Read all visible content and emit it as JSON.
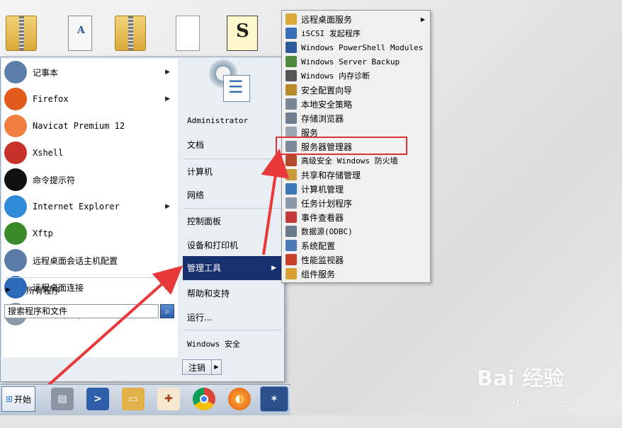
{
  "desktop_icons": [
    "zip-folder-icon",
    "document-icon",
    "zip-folder-icon",
    "blank-file-icon",
    "script-file-icon"
  ],
  "start_menu": {
    "programs": [
      {
        "label": "记事本",
        "icon": "notepad-icon",
        "has_arrow": true
      },
      {
        "label": "Firefox",
        "icon": "firefox-icon",
        "has_arrow": true
      },
      {
        "label": "Navicat Premium 12",
        "icon": "navicat-icon",
        "has_arrow": false
      },
      {
        "label": "Xshell",
        "icon": "xshell-icon",
        "has_arrow": false
      },
      {
        "label": "命令提示符",
        "icon": "cmd-icon",
        "has_arrow": false
      },
      {
        "label": "Internet Explorer",
        "icon": "ie-icon",
        "has_arrow": true
      },
      {
        "label": "Xftp",
        "icon": "xftp-icon",
        "has_arrow": false
      },
      {
        "label": "远程桌面会话主机配置",
        "icon": "rdsh-config-icon",
        "has_arrow": false
      },
      {
        "label": "远程桌面连接",
        "icon": "remote-desktop-icon",
        "has_arrow": true
      },
      {
        "label": "任务计划程序",
        "icon": "task-scheduler-icon",
        "has_arrow": false
      }
    ],
    "all_programs": "所有程序",
    "search_placeholder": "搜索程序和文件",
    "right_items": {
      "user": "Administrator",
      "documents": "文档",
      "computer": "计算机",
      "network": "网络",
      "control_panel": "控制面板",
      "devices": "设备和打印机",
      "admin_tools": "管理工具",
      "help": "帮助和支持",
      "run": "运行...",
      "security": "Windows 安全"
    },
    "logout": "注销"
  },
  "admin_submenu": [
    {
      "label": "远程桌面服务",
      "color": "#d9a93a",
      "has_arrow": true
    },
    {
      "label": "iSCSI 发起程序",
      "color": "#3a6fb8",
      "has_arrow": false
    },
    {
      "label": "Windows PowerShell Modules",
      "color": "#2c5c9c",
      "has_arrow": false
    },
    {
      "label": "Windows Server Backup",
      "color": "#4d8a3c",
      "has_arrow": false
    },
    {
      "label": "Windows 内存诊断",
      "color": "#555555",
      "has_arrow": false
    },
    {
      "label": "安全配置向导",
      "color": "#b88a2a",
      "has_arrow": false
    },
    {
      "label": "本地安全策略",
      "color": "#7a8794",
      "has_arrow": false
    },
    {
      "label": "存储浏览器",
      "color": "#6f7f90",
      "has_arrow": false
    },
    {
      "label": "服务",
      "color": "#9aa5b0",
      "has_arrow": false
    },
    {
      "label": "服务器管理器",
      "color": "#7d8a98",
      "has_arrow": false
    },
    {
      "label": "高级安全 Windows 防火墙",
      "color": "#b44a2a",
      "has_arrow": false
    },
    {
      "label": "共享和存储管理",
      "color": "#c89a3a",
      "has_arrow": false
    },
    {
      "label": "计算机管理",
      "color": "#3a7ab8",
      "has_arrow": false
    },
    {
      "label": "任务计划程序",
      "color": "#8a9aa8",
      "has_arrow": false
    },
    {
      "label": "事件查看器",
      "color": "#c43a3a",
      "has_arrow": false
    },
    {
      "label": "数据源(ODBC)",
      "color": "#6a7a8a",
      "has_arrow": false
    },
    {
      "label": "系统配置",
      "color": "#4a7ab8",
      "has_arrow": false
    },
    {
      "label": "性能监视器",
      "color": "#c8402a",
      "has_arrow": false
    },
    {
      "label": "组件服务",
      "color": "#d8a030",
      "has_arrow": false
    }
  ],
  "taskbar": {
    "start_label": "开始",
    "apps": [
      "server-manager-icon",
      "powershell-icon",
      "explorer-icon",
      "tool-icon",
      "chrome-icon",
      "firefox-icon",
      "network-tool-icon"
    ]
  },
  "watermark": {
    "big": "Bai 经验",
    "small": "jingyan.baidu.com"
  },
  "colors": {
    "active_item": "#17316e",
    "highlight": "#e0303a"
  }
}
